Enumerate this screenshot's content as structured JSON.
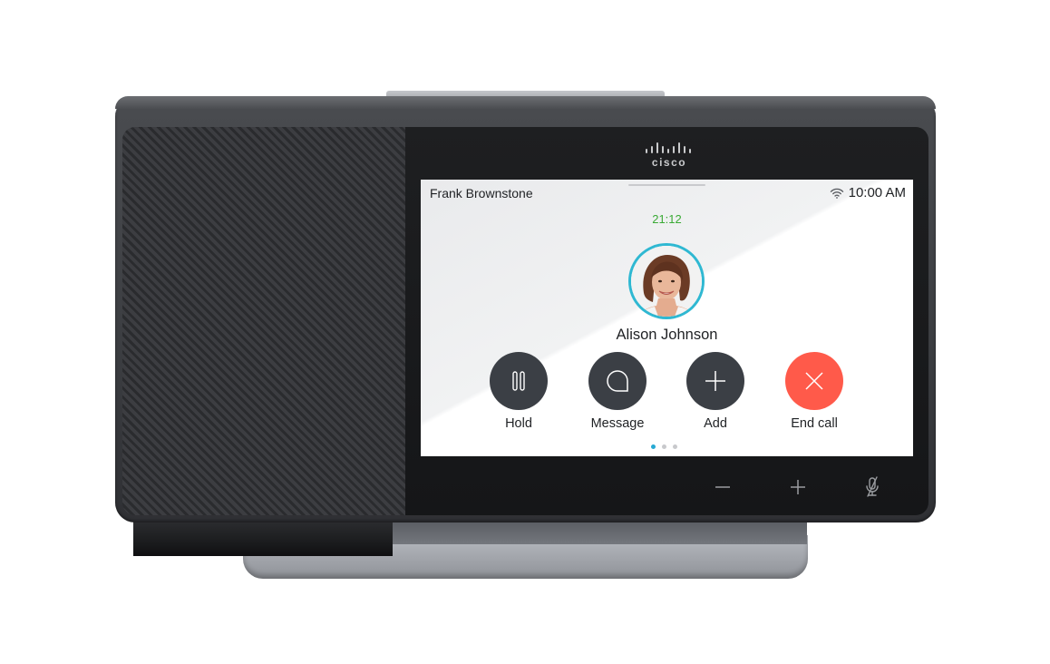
{
  "device": {
    "brand": "cisco",
    "colors": {
      "body": "#3b3d41",
      "speaker_grille": "#333438",
      "bezel": "#1a1b1d",
      "stand": "#a7aab0"
    }
  },
  "status_bar": {
    "caller_name": "Frank Brownstone",
    "wifi_icon": "wifi-icon",
    "time": "10:00 AM"
  },
  "call": {
    "duration": "21:12",
    "contact_name": "Alison Johnson",
    "avatar_ring_color": "#2fb8d2",
    "timer_color": "#3aaa35"
  },
  "actions": [
    {
      "label": "Hold",
      "icon": "pause-icon"
    },
    {
      "label": "Message",
      "icon": "message-icon"
    },
    {
      "label": "Add",
      "icon": "plus-icon"
    },
    {
      "label": "End call",
      "icon": "close-icon",
      "color": "#ff5a4a"
    }
  ],
  "pager": {
    "pages": 3,
    "active": 0
  },
  "hardware_buttons": [
    {
      "name": "volume-down",
      "icon": "minus-icon"
    },
    {
      "name": "volume-up",
      "icon": "plus-icon"
    },
    {
      "name": "mute",
      "icon": "mic-muted-icon"
    }
  ]
}
